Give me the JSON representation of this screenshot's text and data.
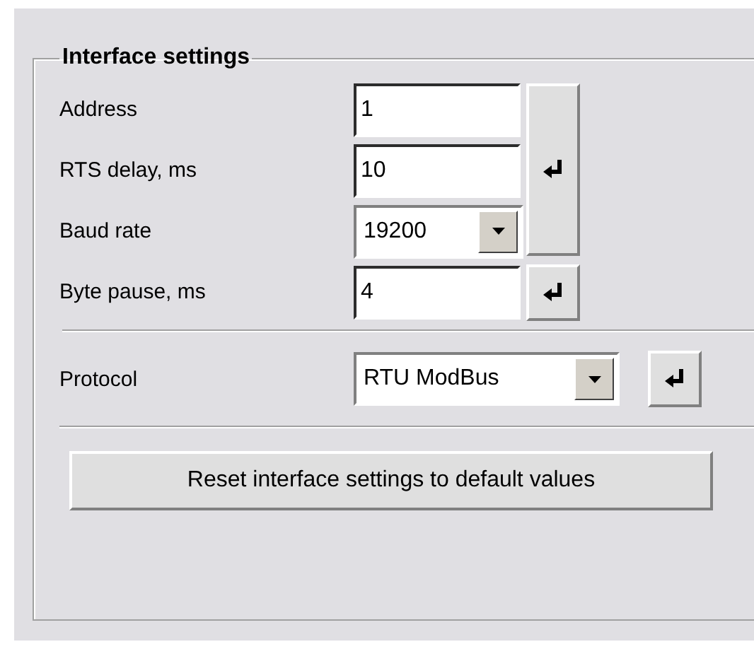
{
  "group": {
    "title": "Interface settings"
  },
  "fields": [
    {
      "label": "Address",
      "kind": "text",
      "value": "1"
    },
    {
      "label": "RTS delay, ms",
      "kind": "text",
      "value": "10"
    },
    {
      "label": "Baud rate",
      "kind": "combo",
      "value": "19200"
    },
    {
      "label": "Byte pause, ms",
      "kind": "text",
      "value": "4"
    }
  ],
  "protocol": {
    "label": "Protocol",
    "kind": "combo",
    "value": "RTU ModBus"
  },
  "reset_button": "Reset interface settings to default values"
}
